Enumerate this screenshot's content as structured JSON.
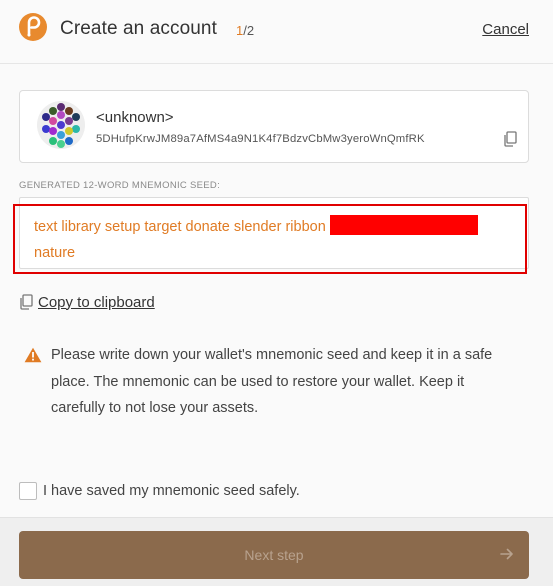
{
  "header": {
    "title": "Create an account",
    "step_current": "1",
    "step_total": "/2",
    "cancel_label": "Cancel",
    "logo_icon": "polkadot-logo-icon"
  },
  "account": {
    "name": "<unknown>",
    "address": "5DHufpKrwJM89a7AfMS4a9N1K4f7BdzvCbMw3yeroWnQmfRK",
    "identicon": "polkadot-identicon",
    "copy_icon": "copy-icon"
  },
  "seed": {
    "label": "GENERATED 12-WORD MNEMONIC SEED:",
    "visible_words_line1": "text library setup target donate slender ribbon",
    "visible_words_line2": "nature",
    "redacted": true
  },
  "copy_clipboard": {
    "label": "Copy to clipboard",
    "icon": "copy-icon"
  },
  "warning": {
    "icon": "warning-triangle-icon",
    "text": "Please write down your wallet's mnemonic seed and keep it in a safe place. The mnemonic can be used to restore your wallet. Keep it carefully to not lose your assets."
  },
  "agree": {
    "label": "I have saved my mnemonic seed safely.",
    "checked": false
  },
  "footer": {
    "next_label": "Next step",
    "disabled": true,
    "arrow_icon": "arrow-right-icon"
  },
  "colors": {
    "accent": "#e07b24",
    "button": "#8b6a4c",
    "highlight": "#e00000",
    "redaction": "#ff0000"
  }
}
